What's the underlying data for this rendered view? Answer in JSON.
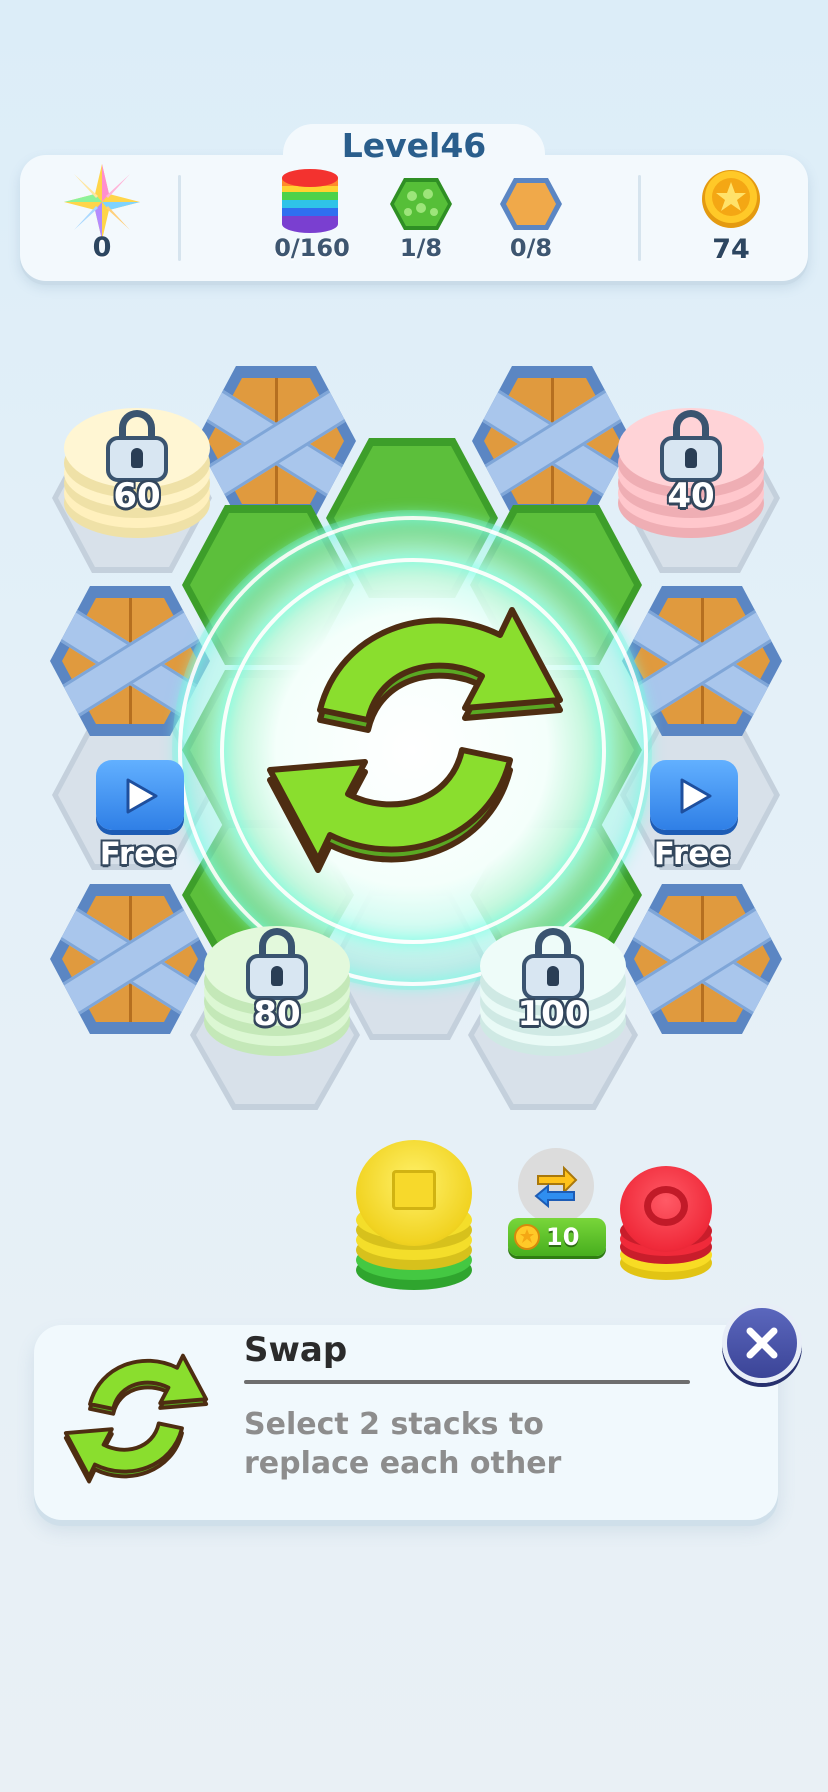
{
  "hud": {
    "level": "Level46",
    "score": "0",
    "goals": [
      {
        "icon": "rainbow-stack-icon",
        "value": "0/160"
      },
      {
        "icon": "clover-hex-icon",
        "value": "1/8"
      },
      {
        "icon": "wood-hex-icon",
        "value": "0/8"
      }
    ],
    "coins": "74"
  },
  "board": {
    "locked_stacks": [
      {
        "name": "locked-stack-60",
        "unlock": "60",
        "color": "#fff3c4"
      },
      {
        "name": "locked-stack-40",
        "unlock": "40",
        "color": "#ffc7cc"
      },
      {
        "name": "locked-stack-80",
        "unlock": "80",
        "color": "#d9f7d0"
      },
      {
        "name": "locked-stack-100",
        "unlock": "100",
        "color": "#e7f8f4"
      }
    ],
    "free_left": "Free",
    "free_right": "Free"
  },
  "tray": {
    "swap_cost": "10",
    "stack_colors": {
      "yellow": "#f4de2a",
      "green": "#44c842",
      "red": "#f02a3a"
    }
  },
  "swap_panel": {
    "title": "Swap",
    "description": "Select 2 stacks to replace each other"
  },
  "colors": {
    "accent_green": "#6cc62c",
    "hud_text": "#2a5e8c",
    "close_button": "#4550a8"
  }
}
